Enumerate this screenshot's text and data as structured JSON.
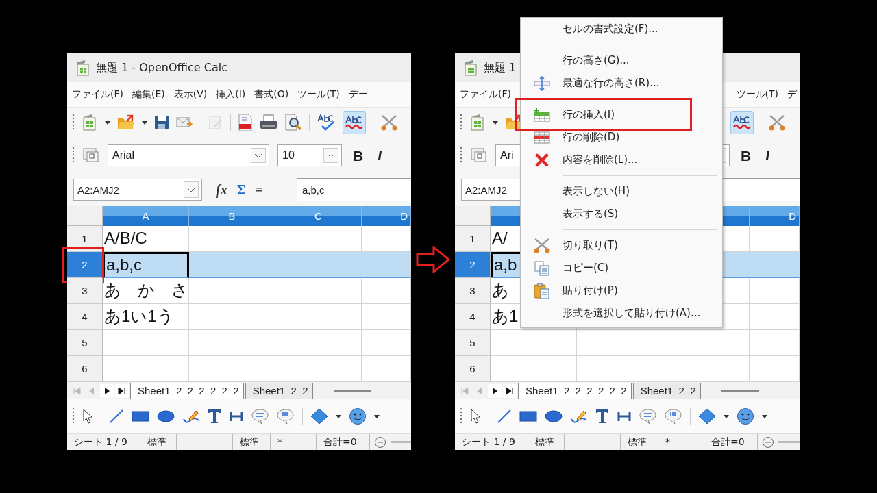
{
  "panels": [
    {
      "title": "無題 1 - OpenOffice Calc",
      "menubar": {
        "left": [
          "ファイル(F)",
          "編集(E)",
          "表示(V)",
          "挿入(I)",
          "書式(O)",
          "ツール(T)",
          "デー"
        ]
      },
      "auto_spellcheck": true,
      "font_name": "Arial",
      "font_size": "10",
      "format_buttons": [
        "B",
        "I"
      ],
      "name_box": "A2:AMJ2",
      "formula_buttons": [
        "fx",
        "Σ",
        "="
      ],
      "formula": "a,b,c",
      "column_headers": [
        "A",
        "B",
        "C",
        "D"
      ],
      "rows": [
        {
          "number": "1",
          "selected": false,
          "annotated": false,
          "cells": [
            {
              "text": "A/B/C",
              "cursor": false
            }
          ]
        },
        {
          "number": "2",
          "selected": true,
          "annotated": true,
          "cells": [
            {
              "text": "a,b,c",
              "cursor": true
            }
          ]
        },
        {
          "number": "3",
          "selected": false,
          "annotated": false,
          "cells": [
            {
              "text": "あ　か　さ",
              "cursor": false
            }
          ]
        },
        {
          "number": "4",
          "selected": false,
          "annotated": false,
          "cells": [
            {
              "text": "あ1い1う",
              "cursor": false
            }
          ]
        },
        {
          "number": "5",
          "selected": false,
          "annotated": false,
          "cells": []
        },
        {
          "number": "6",
          "selected": false,
          "annotated": false,
          "cells": []
        }
      ],
      "sheet_tabs": [
        {
          "label": "Sheet1_2_2_2_2_2_2",
          "selected": true
        },
        {
          "label": "Sheet1_2_2",
          "selected": false
        }
      ],
      "status": [
        "シート 1 / 9",
        "標準",
        "標準",
        "*",
        "合計=0"
      ]
    },
    {
      "title": "無題 1",
      "menubar": {
        "left": [
          "ファイル(F)"
        ],
        "right": [
          "ツール(T)",
          "デ"
        ]
      },
      "auto_spellcheck": true,
      "font_name": "Ari",
      "format_buttons": [
        "B",
        "I"
      ],
      "name_box": "A2:AMJ2",
      "column_headers": [
        "D"
      ],
      "rows": [
        {
          "number": "1",
          "selected": false,
          "annotated": false,
          "cells": [
            {
              "text": "A/",
              "cursor": false
            }
          ]
        },
        {
          "number": "2",
          "selected": true,
          "annotated": false,
          "cells": [
            {
              "text": "a,b",
              "cursor": true
            }
          ]
        },
        {
          "number": "3",
          "selected": false,
          "annotated": false,
          "cells": [
            {
              "text": "あ",
              "cursor": false
            }
          ]
        },
        {
          "number": "4",
          "selected": false,
          "annotated": false,
          "cells": [
            {
              "text": "あ1",
              "cursor": false
            }
          ]
        },
        {
          "number": "5",
          "selected": false,
          "annotated": false,
          "cells": []
        },
        {
          "number": "6",
          "selected": false,
          "annotated": false,
          "cells": []
        }
      ],
      "sheet_tabs": [
        {
          "label": "Sheet1_2_2_2_2_2_2",
          "selected": true
        },
        {
          "label": "Sheet1_2_2",
          "selected": false
        }
      ],
      "status": [
        "シート 1 / 9",
        "標準",
        "標準",
        "*",
        "合計=0"
      ],
      "context_menu": {
        "items": [
          {
            "kind": "plain",
            "label": "セルの書式設定(F)...",
            "annotated": false
          },
          {
            "kind": "separator"
          },
          {
            "kind": "plain",
            "label": "行の高さ(G)...",
            "annotated": false
          },
          {
            "kind": "fit-height",
            "label": "最適な行の高さ(R)...",
            "annotated": false
          },
          {
            "kind": "separator"
          },
          {
            "kind": "insert-row",
            "label": "行の挿入(I)",
            "annotated": true
          },
          {
            "kind": "delete-row",
            "label": "行の削除(D)",
            "annotated": false
          },
          {
            "kind": "clear",
            "label": "内容を削除(L)...",
            "annotated": false
          },
          {
            "kind": "separator"
          },
          {
            "kind": "plain",
            "label": "表示しない(H)",
            "annotated": false
          },
          {
            "kind": "plain",
            "label": "表示する(S)",
            "annotated": false
          },
          {
            "kind": "separator"
          },
          {
            "kind": "cut",
            "label": "切り取り(T)",
            "annotated": false
          },
          {
            "kind": "copy",
            "label": "コピー(C)",
            "annotated": false
          },
          {
            "kind": "paste",
            "label": "貼り付け(P)",
            "annotated": false
          },
          {
            "kind": "plain",
            "label": "形式を選択して貼り付け(A)...",
            "annotated": false
          }
        ]
      }
    }
  ]
}
